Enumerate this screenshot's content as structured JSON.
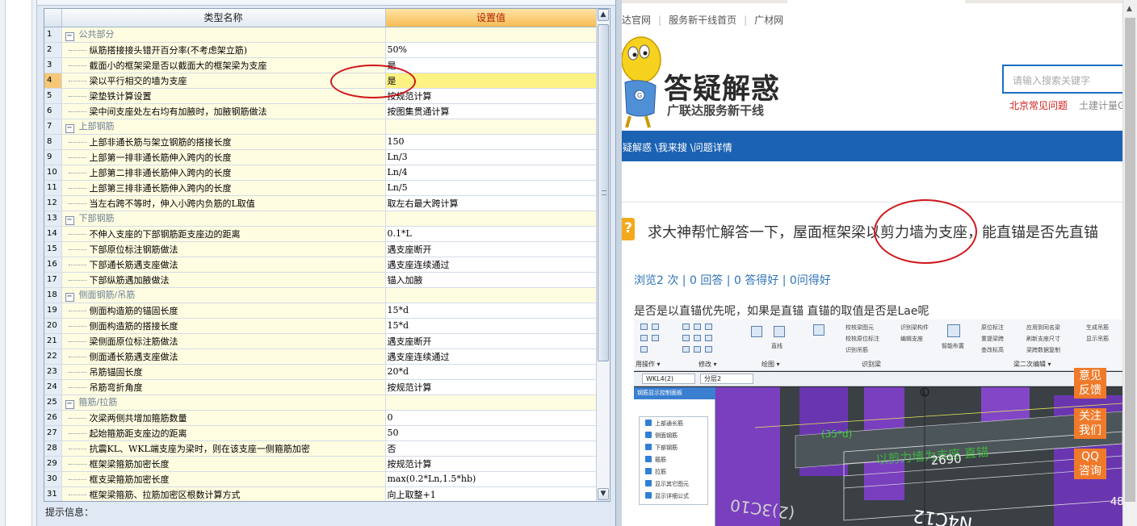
{
  "grid": {
    "header_name": "类型名称",
    "header_value": "设置值",
    "rows": [
      {
        "n": "1",
        "name": "公共部分",
        "value": "",
        "group": true
      },
      {
        "n": "2",
        "name": "纵筋搭接接头错开百分率(不考虑架立筋)",
        "value": "50%"
      },
      {
        "n": "3",
        "name": "截面小的框架梁是否以截面大的框架梁为支座",
        "value": "是"
      },
      {
        "n": "4",
        "name": "梁以平行相交的墙为支座",
        "value": "是",
        "selected": true
      },
      {
        "n": "5",
        "name": "梁垫铁计算设置",
        "value": "按规范计算"
      },
      {
        "n": "6",
        "name": "梁中间支座处左右均有加腋时，加腋钢筋做法",
        "value": "按图集贯通计算"
      },
      {
        "n": "7",
        "name": "上部钢筋",
        "value": "",
        "group": true
      },
      {
        "n": "8",
        "name": "上部非通长筋与架立钢筋的搭接长度",
        "value": "150"
      },
      {
        "n": "9",
        "name": "上部第一排非通长筋伸入跨内的长度",
        "value": "Ln/3"
      },
      {
        "n": "10",
        "name": "上部第二排非通长筋伸入跨内的长度",
        "value": "Ln/4"
      },
      {
        "n": "11",
        "name": "上部第三排非通长筋伸入跨内的长度",
        "value": "Ln/5"
      },
      {
        "n": "12",
        "name": "当左右跨不等时，伸入小跨内负筋的L取值",
        "value": "取左右最大跨计算"
      },
      {
        "n": "13",
        "name": "下部钢筋",
        "value": "",
        "group": true
      },
      {
        "n": "14",
        "name": "不伸入支座的下部钢筋距支座边的距离",
        "value": "0.1*L"
      },
      {
        "n": "15",
        "name": "下部原位标注钢筋做法",
        "value": "遇支座断开"
      },
      {
        "n": "16",
        "name": "下部通长筋遇支座做法",
        "value": "遇支座连续通过"
      },
      {
        "n": "17",
        "name": "下部纵筋遇加腋做法",
        "value": "锚入加腋"
      },
      {
        "n": "18",
        "name": "侧面钢筋/吊筋",
        "value": "",
        "group": true
      },
      {
        "n": "19",
        "name": "侧面构造筋的锚固长度",
        "value": "15*d"
      },
      {
        "n": "20",
        "name": "侧面构造筋的搭接长度",
        "value": "15*d"
      },
      {
        "n": "21",
        "name": "梁侧面原位标注筋做法",
        "value": "遇支座断开"
      },
      {
        "n": "22",
        "name": "侧面通长筋遇支座做法",
        "value": "遇支座连续通过"
      },
      {
        "n": "23",
        "name": "吊筋锚固长度",
        "value": "20*d"
      },
      {
        "n": "24",
        "name": "吊筋弯折角度",
        "value": "按规范计算"
      },
      {
        "n": "25",
        "name": "箍筋/拉筋",
        "value": "",
        "group": true
      },
      {
        "n": "26",
        "name": "次梁两侧共增加箍筋数量",
        "value": "0"
      },
      {
        "n": "27",
        "name": "起始箍筋距支座边的距离",
        "value": "50"
      },
      {
        "n": "28",
        "name": "抗震KL、WKL端支座为梁时，则在该支座一侧箍筋加密",
        "value": "否"
      },
      {
        "n": "29",
        "name": "框架梁箍筋加密长度",
        "value": "按规范计算"
      },
      {
        "n": "30",
        "name": "框支梁箍筋加密长度",
        "value": "max(0.2*Ln,1.5*hb)"
      },
      {
        "n": "31",
        "name": "框架梁箍筋、拉筋加密区根数计算方式",
        "value": "向上取整+1"
      }
    ]
  },
  "hint_label": "提示信息：",
  "scroll_up_glyph": "▲",
  "scroll_down_glyph": "▼",
  "browser": {
    "nav_links": [
      "达官网",
      "服务新干线首页",
      "广材网"
    ],
    "logo_title": "答疑解惑",
    "logo_subtitle": "广联达服务新干线",
    "search_placeholder": "请输入搜索关键字",
    "quick_link_1": "北京常见问题",
    "quick_link_2": "土建计量G",
    "breadcrumb": "疑解惑 \\我来搜 \\问题详情",
    "question_badge": "?",
    "question_title": "求大神帮忙解答一下，屋面框架梁以剪力墙为支座，能直锚是否先直锚",
    "stats": "浏览2 次 | 0 回答 | 0 答得好 | 0问得好",
    "body": "是否是以直锚优先呢，如果是直锚 直锚的取值是否是Lae呢"
  },
  "screenshot": {
    "ribbon_groups": [
      "用操作 ▾",
      "修改 ▾",
      "绘图 ▾",
      "识别梁",
      "梁二次编辑 ▾"
    ],
    "ribbon_texts": [
      "直线",
      "智能布置",
      "原位标注",
      "应用到同名梁",
      "生成吊筋",
      "重提梁跨",
      "刷新支座尺寸",
      "显示吊筋",
      "查改标高",
      "梁跨数据复制",
      "校核梁图元",
      "识别梁构件",
      "校核原位标注",
      "编辑支座",
      "识别吊筋"
    ],
    "dropdown_1": "WKL4(2)",
    "dropdown_2": "分层2",
    "panel_title": "钢筋显示控制面板",
    "checkboxes": [
      "上部通长筋",
      "侧面钢筋",
      "下部钢筋",
      "箍筋",
      "拉筋",
      "显示其它图元",
      "显示详细公式"
    ],
    "label_l": "L",
    "label_2690": "2690",
    "label_35d": "(35*d)",
    "label_n4c12": "N4C12",
    "label_3c10": "(2)3C10",
    "label_48": "48",
    "label_watermark": "以剪力墙为支座 直锚"
  },
  "side_buttons": [
    "意见反馈",
    "关注我们",
    "QQ咨询"
  ],
  "colors": {
    "header_value_bg": "#f7bc54",
    "selected_row": "#fff284",
    "name_cell_bg": "#fffde1",
    "browser_nav_blue": "#1b62b3",
    "highlight_red": "#d0151a",
    "side_button_orange": "#f07a2a"
  }
}
